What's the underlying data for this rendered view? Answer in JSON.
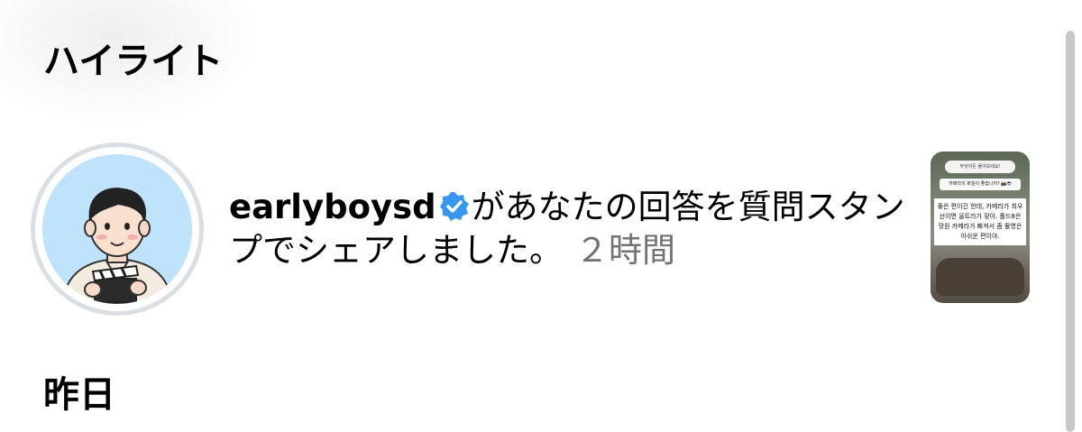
{
  "sections": {
    "highlights_title": "ハイライト",
    "yesterday_title": "昨日"
  },
  "notification": {
    "username": "earlyboysd",
    "verified": true,
    "message": "があなたの回答を質問スタンプでシェアしました。",
    "timestamp": "２時間",
    "avatar_icon": "cartoon-man-with-clapperboard",
    "thumbnail": {
      "sticker_top": "무엇이든 물어보세요!",
      "question": "카메라의 화질이 좋습니까? 📸😎",
      "answer": "좋은 편이긴 한데, 카메라가 최우선이면 울트라가 맞아. 폴드8은 망원 카메라가 빠져서 좀 촬영은 아쉬운 편이야."
    }
  },
  "colors": {
    "verified_badge": "#3797f0",
    "timestamp": "#737373",
    "avatar_background": "#bfe3fb",
    "avatar_ring": "#dbdfe4",
    "scrollbar": "#c7c7c7"
  }
}
